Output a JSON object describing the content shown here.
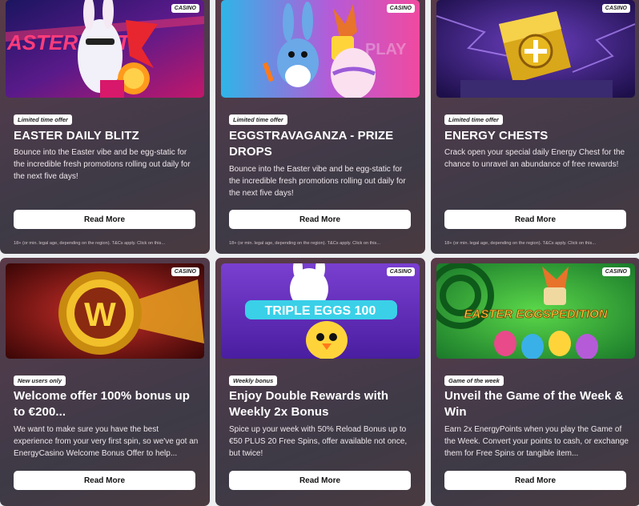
{
  "cards": [
    {
      "tag": "CASINO",
      "badge": "Limited time offer",
      "title": "EASTER DAILY BLITZ",
      "description": "Bounce into the Easter vibe and be egg-static for the incredible fresh promotions rolling out daily for the next five days!",
      "button": "Read More",
      "legal": "18+ (or min. legal age, depending on the region). T&Cs apply. Click on this..."
    },
    {
      "tag": "CASINO",
      "badge": "Limited time offer",
      "title": "EGGSTRAVAGANZA - PRIZE DROPS",
      "description": "Bounce into the Easter vibe and be egg-static for the incredible fresh promotions rolling out daily for the next five days!",
      "button": "Read More",
      "legal": "18+ (or min. legal age, depending on the region). T&Cs apply. Click on this..."
    },
    {
      "tag": "CASINO",
      "badge": "Limited time offer",
      "title": "ENERGY CHESTS",
      "description": "Crack open your special daily Energy Chest for the chance to unravel an abundance of free rewards!",
      "button": "Read More",
      "legal": "18+ (or min. legal age, depending on the region). T&Cs apply. Click on this..."
    },
    {
      "tag": "CASINO",
      "badge": "New users only",
      "title": "Welcome offer 100% bonus up to €200...",
      "description": "We want to make sure you have the best experience from your very first spin, so we've got an EnergyCasino Welcome Bonus Offer to help...",
      "button": "Read More"
    },
    {
      "tag": "CASINO",
      "badge": "Weekly bonus",
      "title": "Enjoy Double Rewards with Weekly 2x Bonus",
      "description": "Spice up your week with 50% Reload Bonus up to €50 PLUS 20 Free Spins, offer available not once, but twice!",
      "button": "Read More"
    },
    {
      "tag": "CASINO",
      "badge": "Game of the week",
      "title": "Unveil the Game of the Week & Win",
      "description": "Earn 2x EnergyPoints when you play the Game of the Week. Convert your points to cash, or exchange them for Free Spins or tangible item...",
      "button": "Read More"
    }
  ],
  "artwork": {
    "blitz_text": "ASTER BLITZ",
    "triple_eggs_text": "TRIPLE EGGS 100",
    "eggspedition_text": "EASTER EGGSPEDITION",
    "welcome_coin_letter": "W",
    "play_text": "PLAY"
  },
  "colors": {
    "card_bg": "#4b3b4a",
    "button_bg": "#ffffff",
    "page_bg": "#eceef0"
  }
}
